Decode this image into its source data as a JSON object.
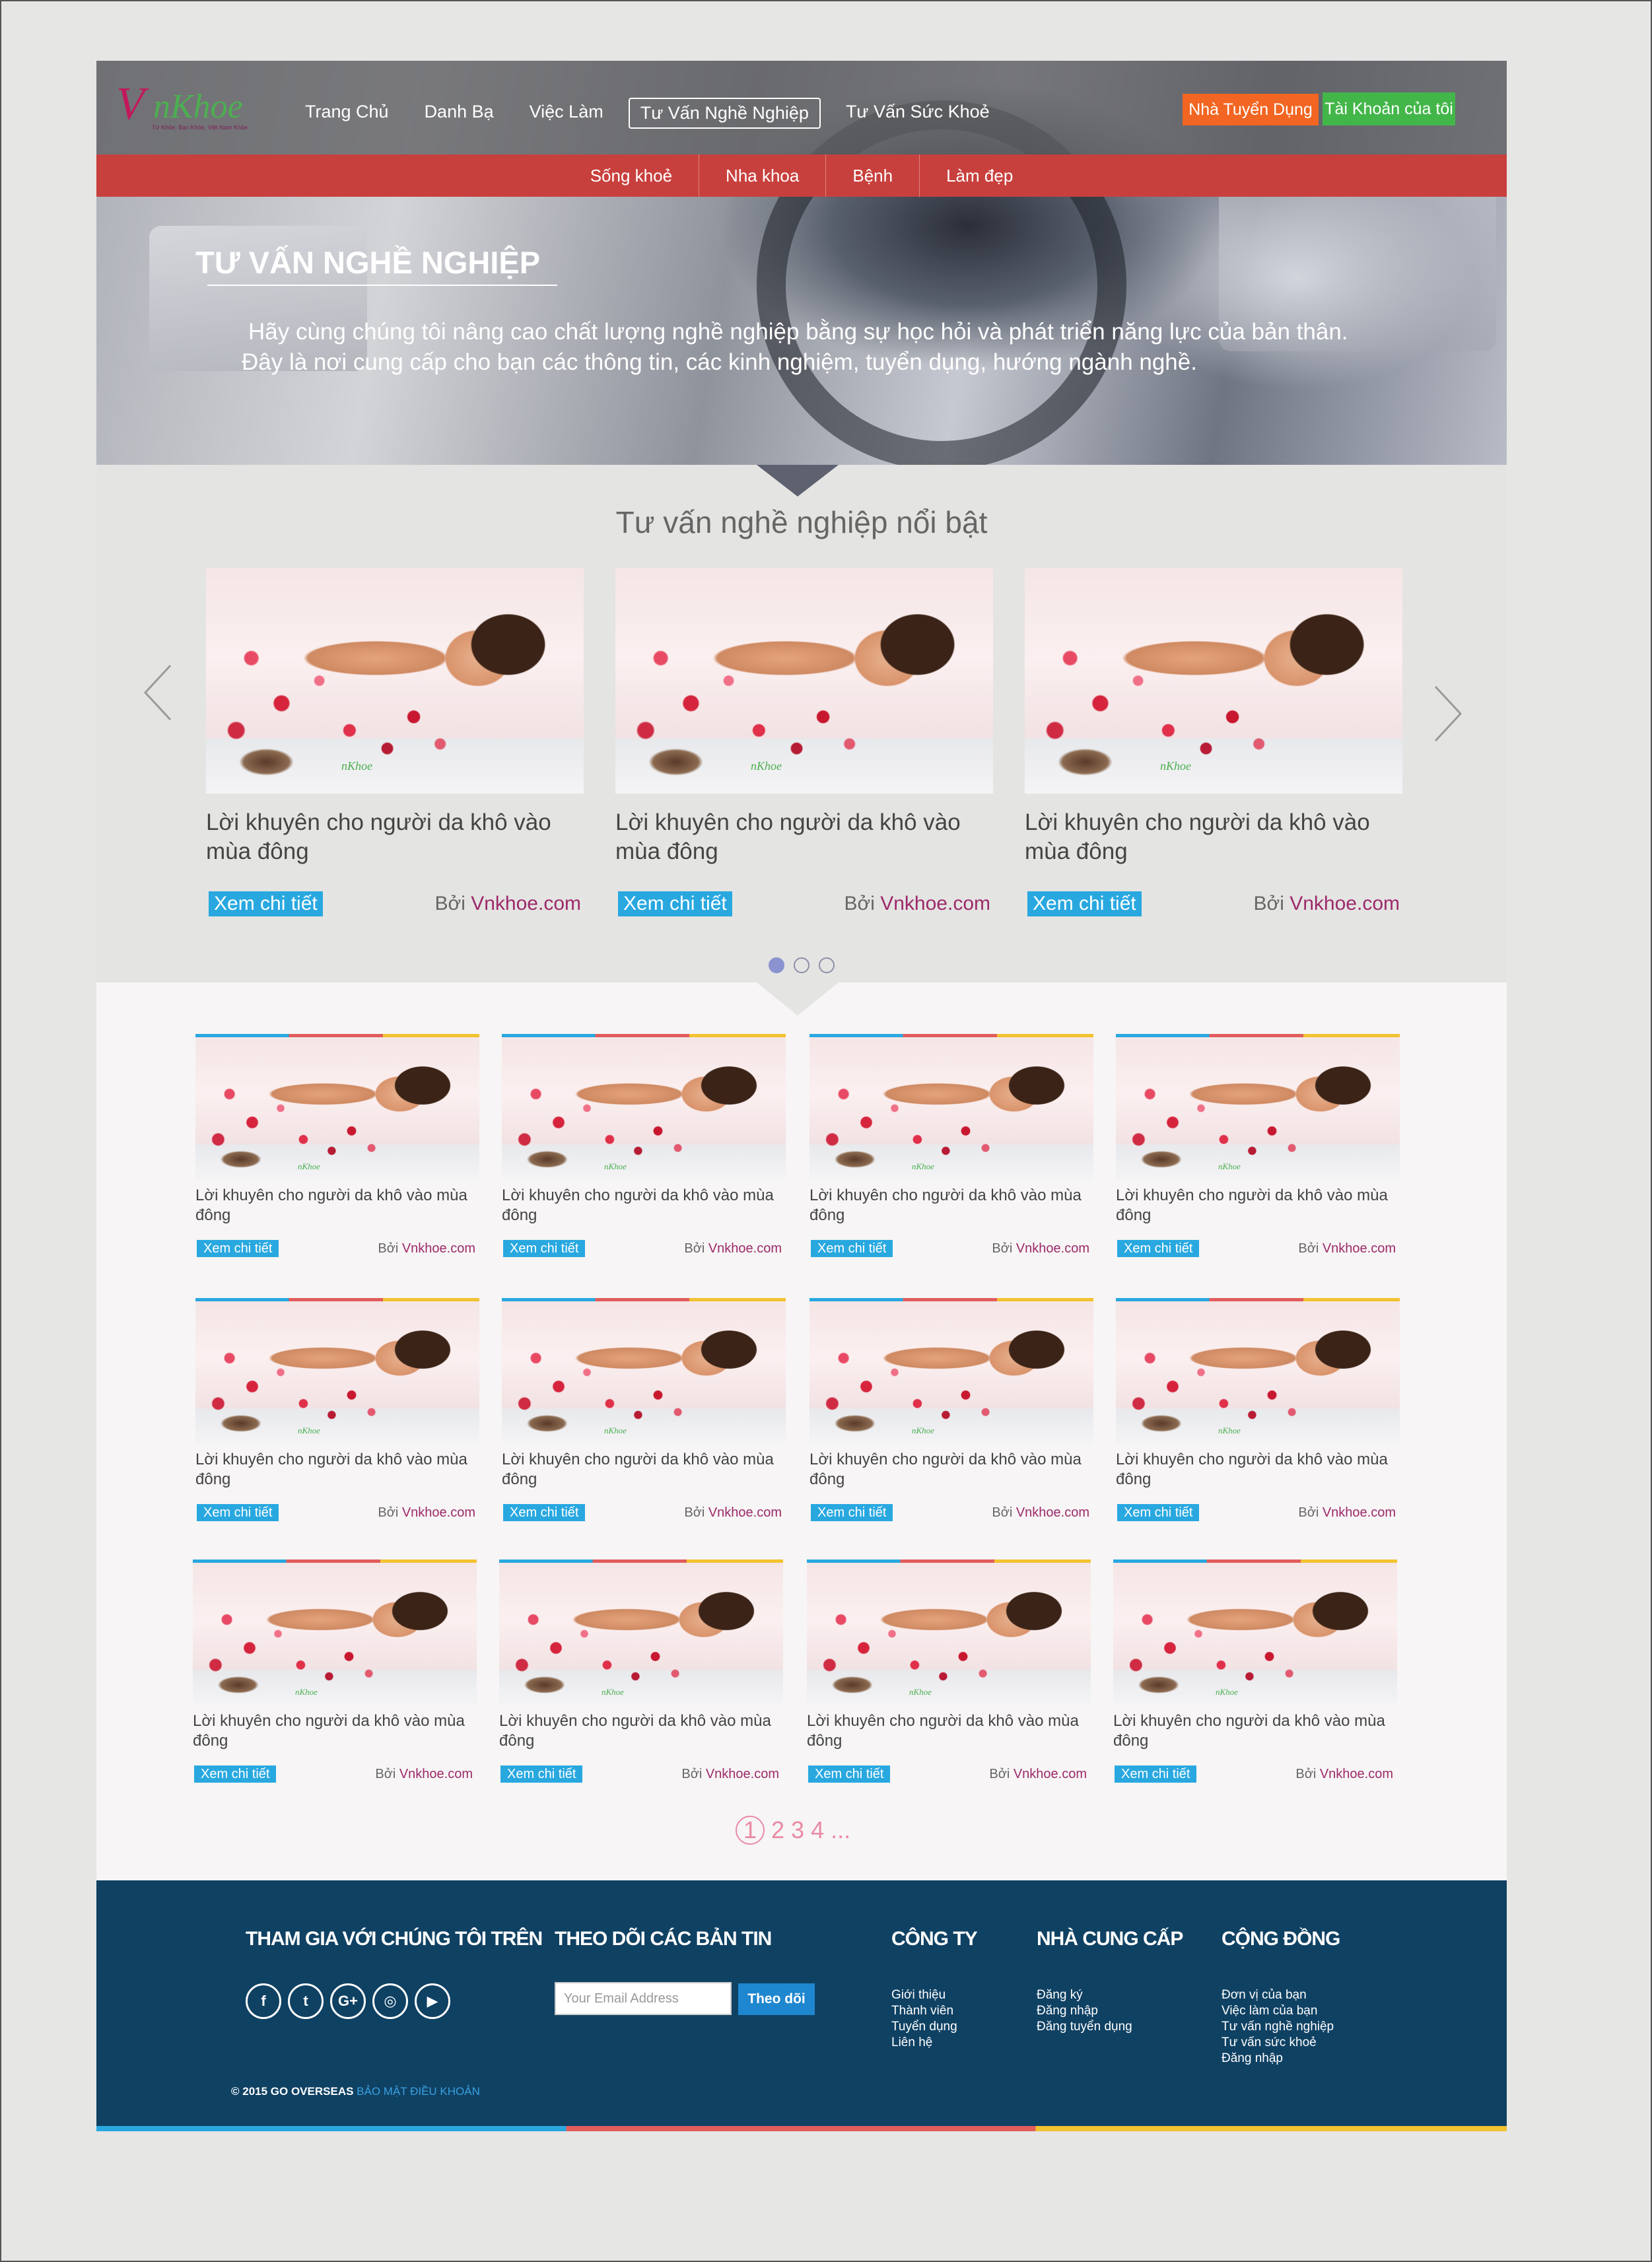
{
  "logo": {
    "text_v": "V",
    "text_main": "nKhoe",
    "tagline": "Từ Khỏe, Bạn Khỏe, Việt Nam Khỏe"
  },
  "nav": {
    "items": [
      "Trang Chủ",
      "Danh Bạ",
      "Việc Làm",
      "Tư Vấn Nghề Nghiệp",
      "Tư Vấn Sức Khoẻ"
    ],
    "active_index": 3,
    "employer_button": "Nhà Tuyển Dụng",
    "account_button": "Tài Khoản của tôi"
  },
  "subnav": {
    "items": [
      "Sống khoẻ",
      "Nha khoa",
      "Bệnh",
      "Làm đẹp"
    ]
  },
  "hero": {
    "title": "TƯ VẤN NGHỀ NGHIỆP",
    "line1": "Hãy cùng chúng tôi nâng cao chất lượng nghề nghiệp bằng sự học hỏi và phát triển năng lực của bản thân.",
    "line2": "Đây là nơi cung cấp cho bạn các thông tin, các kinh nghiệm, tuyển dụng, hướng ngành nghề."
  },
  "featured": {
    "title": "Tư vấn nghề nghiệp nổi bật",
    "cards": [
      {
        "title": "Lời khuyên cho người da khô vào mùa đông",
        "more": "Xem chi tiết",
        "by": "Bởi",
        "site": "Vnkhoe.com"
      },
      {
        "title": "Lời khuyên cho người da khô vào mùa đông",
        "more": "Xem chi tiết",
        "by": "Bởi",
        "site": "Vnkhoe.com"
      },
      {
        "title": "Lời khuyên cho người da khô vào mùa đông",
        "more": "Xem chi tiết",
        "by": "Bởi",
        "site": "Vnkhoe.com"
      }
    ],
    "dots": 3,
    "active_dot": 0
  },
  "grid": {
    "cards": [
      {
        "title": "Lời khuyên cho người da khô vào mùa đông",
        "more": "Xem chi tiết",
        "by": "Bởi",
        "site": "Vnkhoe.com"
      },
      {
        "title": "Lời khuyên cho người da khô vào mùa đông",
        "more": "Xem chi tiết",
        "by": "Bởi",
        "site": "Vnkhoe.com"
      },
      {
        "title": "Lời khuyên cho người da khô vào mùa đông",
        "more": "Xem chi tiết",
        "by": "Bởi",
        "site": "Vnkhoe.com"
      },
      {
        "title": "Lời khuyên cho người da khô vào mùa đông",
        "more": "Xem chi tiết",
        "by": "Bởi",
        "site": "Vnkhoe.com"
      },
      {
        "title": "Lời khuyên cho người da khô vào mùa đông",
        "more": "Xem chi tiết",
        "by": "Bởi",
        "site": "Vnkhoe.com"
      },
      {
        "title": "Lời khuyên cho người da khô vào mùa đông",
        "more": "Xem chi tiết",
        "by": "Bởi",
        "site": "Vnkhoe.com"
      },
      {
        "title": "Lời khuyên cho người da khô vào mùa đông",
        "more": "Xem chi tiết",
        "by": "Bởi",
        "site": "Vnkhoe.com"
      },
      {
        "title": "Lời khuyên cho người da khô vào mùa đông",
        "more": "Xem chi tiết",
        "by": "Bởi",
        "site": "Vnkhoe.com"
      },
      {
        "title": "Lời khuyên cho người da khô vào mùa đông",
        "more": "Xem chi tiết",
        "by": "Bởi",
        "site": "Vnkhoe.com"
      },
      {
        "title": "Lời khuyên cho người da khô vào mùa đông",
        "more": "Xem chi tiết",
        "by": "Bởi",
        "site": "Vnkhoe.com"
      },
      {
        "title": "Lời khuyên cho người da khô vào mùa đông",
        "more": "Xem chi tiết",
        "by": "Bởi",
        "site": "Vnkhoe.com"
      },
      {
        "title": "Lời khuyên cho người da khô vào mùa đông",
        "more": "Xem chi tiết",
        "by": "Bởi",
        "site": "Vnkhoe.com"
      }
    ]
  },
  "pagination": {
    "current": "1",
    "pages": [
      "2",
      "3",
      "4",
      "..."
    ]
  },
  "footer": {
    "join_heading": "THAM GIA VỚI CHÚNG TÔI TRÊN",
    "newsletter_heading": "THEO DÕI CÁC BẢN TIN",
    "email_placeholder": "Your Email Address",
    "follow_button": "Theo dõi",
    "company_heading": "CÔNG TY",
    "company_links": [
      "Giới thiệu",
      "Thành viên",
      "Tuyển dụng",
      "Liên hệ"
    ],
    "provider_heading": "NHÀ CUNG CẤP",
    "provider_links": [
      "Đăng ký",
      "Đăng nhập",
      "Đăng tuyển dụng"
    ],
    "community_heading": "CỘNG ĐỒNG",
    "community_links": [
      "Đơn vị của bạn",
      "Việc làm của bạn",
      "Tư vấn nghề nghiệp",
      "Tư vấn sức khoẻ",
      "Đăng nhập"
    ],
    "socials": [
      {
        "icon": "facebook-icon",
        "glyph": "f"
      },
      {
        "icon": "twitter-icon",
        "glyph": "t"
      },
      {
        "icon": "google-plus-icon",
        "glyph": "G+"
      },
      {
        "icon": "instagram-icon",
        "glyph": "◎"
      },
      {
        "icon": "youtube-icon",
        "glyph": "▶"
      }
    ],
    "copyright": "© 2015 GO OVERSEAS",
    "terms": "BẢO MẬT ĐIỀU KHOẢN"
  },
  "colors": {
    "subnav": "#c8403d",
    "footer": "#0f4163",
    "link_button": "#29a8e0",
    "employer": "#f26522",
    "account": "#43b649",
    "site_link": "#9c2a6a"
  }
}
